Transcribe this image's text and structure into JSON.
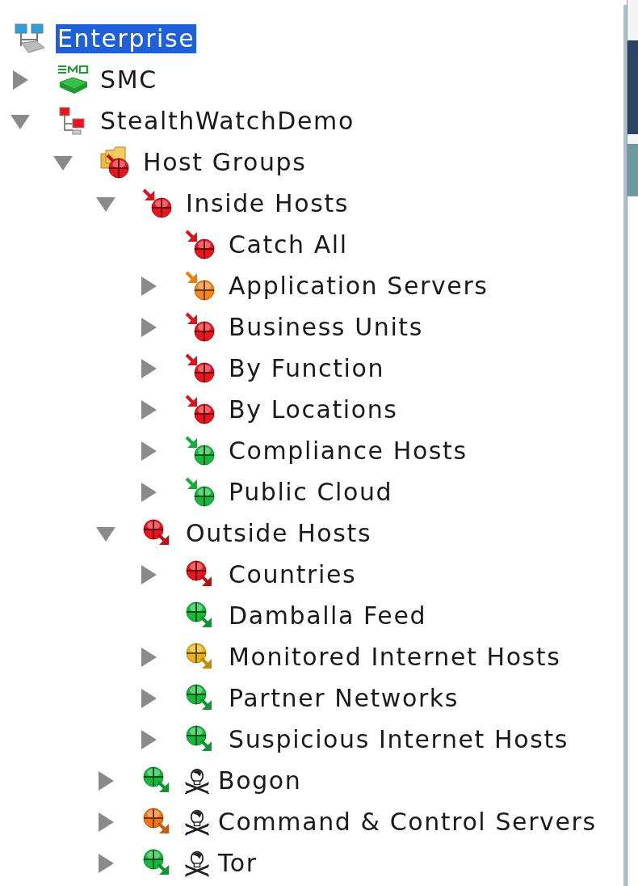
{
  "tree": [
    {
      "label": "Enterprise",
      "kind": "network",
      "selected": true,
      "children": [
        {
          "label": "SMC",
          "kind": "smc",
          "selected": false,
          "expanded": false
        },
        {
          "label": "StealthWatchDemo",
          "kind": "domain",
          "selected": false,
          "expanded": true,
          "children": [
            {
              "label": "Host Groups",
              "kind": "host-groups",
              "selected": false,
              "expanded": true,
              "children": [
                {
                  "label": "Inside Hosts",
                  "kind": "inside",
                  "color": "#e8141e",
                  "selected": false,
                  "expanded": true,
                  "children": [
                    {
                      "label": "Catch All",
                      "kind": "inside",
                      "color": "#e8141e",
                      "selected": false
                    },
                    {
                      "label": "Application Servers",
                      "kind": "inside",
                      "color": "#f58412",
                      "selected": false,
                      "expanded": false
                    },
                    {
                      "label": "Business Units",
                      "kind": "inside",
                      "color": "#e8141e",
                      "selected": false,
                      "expanded": false
                    },
                    {
                      "label": "By Function",
                      "kind": "inside",
                      "color": "#e8141e",
                      "selected": false,
                      "expanded": false
                    },
                    {
                      "label": "By Locations",
                      "kind": "inside",
                      "color": "#e8141e",
                      "selected": false,
                      "expanded": false
                    },
                    {
                      "label": "Compliance Hosts",
                      "kind": "inside",
                      "color": "#14b83c",
                      "selected": false,
                      "expanded": false
                    },
                    {
                      "label": "Public Cloud",
                      "kind": "inside",
                      "color": "#14b83c",
                      "selected": false,
                      "expanded": false
                    }
                  ]
                },
                {
                  "label": "Outside Hosts",
                  "kind": "outside",
                  "color": "#e8141e",
                  "selected": false,
                  "expanded": true,
                  "children": [
                    {
                      "label": "Countries",
                      "kind": "outside",
                      "color": "#e8141e",
                      "selected": false,
                      "expanded": false
                    },
                    {
                      "label": "Damballa Feed",
                      "kind": "outside",
                      "color": "#14b83c",
                      "selected": false
                    },
                    {
                      "label": "Monitored Internet Hosts",
                      "kind": "outside",
                      "color": "#e8b010",
                      "selected": false,
                      "expanded": false
                    },
                    {
                      "label": "Partner Networks",
                      "kind": "outside",
                      "color": "#14b83c",
                      "selected": false,
                      "expanded": false
                    },
                    {
                      "label": "Suspicious Internet Hosts",
                      "kind": "outside",
                      "color": "#14b83c",
                      "selected": false,
                      "expanded": false
                    }
                  ]
                },
                {
                  "label": "Bogon",
                  "kind": "outside",
                  "color": "#14b83c",
                  "threat": true,
                  "selected": false,
                  "expanded": false
                },
                {
                  "label": "Command & Control Servers",
                  "kind": "outside",
                  "color": "#f57212",
                  "threat": true,
                  "selected": false,
                  "expanded": false
                },
                {
                  "label": "Tor",
                  "kind": "outside",
                  "color": "#14b83c",
                  "threat": true,
                  "selected": false,
                  "expanded": false
                }
              ]
            }
          ]
        }
      ]
    }
  ]
}
